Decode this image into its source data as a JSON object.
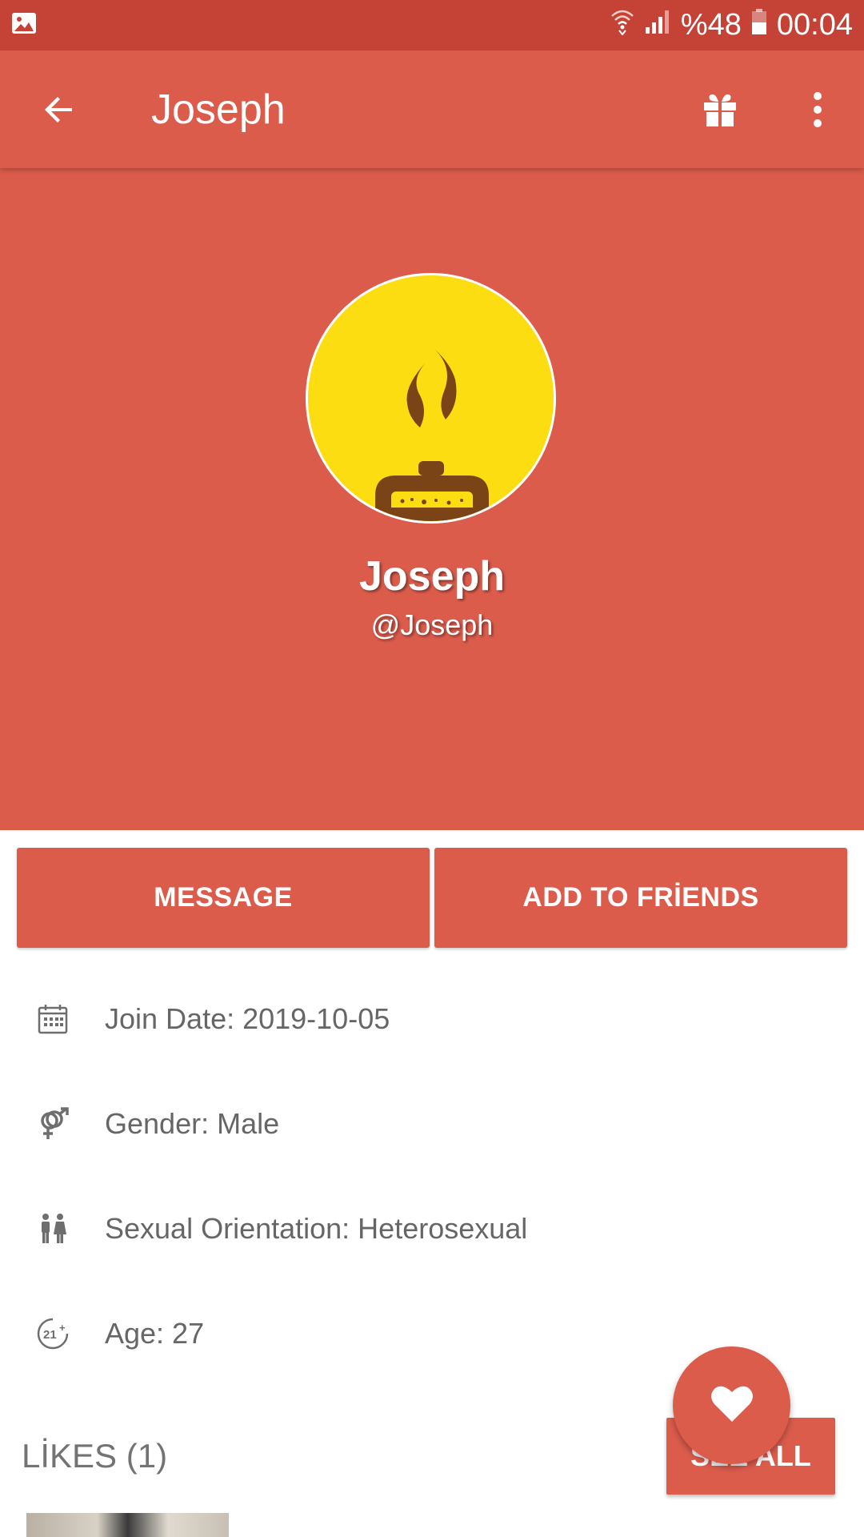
{
  "status_bar": {
    "battery": "%48",
    "time": "00:04",
    "icons": [
      "image-notification-icon",
      "wifi-icon",
      "signal-icon",
      "battery-icon"
    ]
  },
  "app_bar": {
    "title": "Joseph",
    "icons": [
      "back-arrow-icon",
      "gift-icon",
      "more-vert-icon"
    ]
  },
  "profile": {
    "name": "Joseph",
    "handle": "@Joseph",
    "avatar_color": "#fcdd11"
  },
  "actions": {
    "message_label": "MESSAGE",
    "add_friends_label": "ADD TO FRİENDS"
  },
  "info": {
    "join_date": "Join Date: 2019-10-05",
    "gender": "Gender: Male",
    "orientation": "Sexual Orientation: Heterosexual",
    "age": "Age: 27"
  },
  "likes": {
    "label": "LİKES (1)",
    "see_all_label": "SEE ALL"
  },
  "colors": {
    "primary": "#dc5c4c",
    "status_bar": "#c54336",
    "text_secondary": "#666666"
  }
}
